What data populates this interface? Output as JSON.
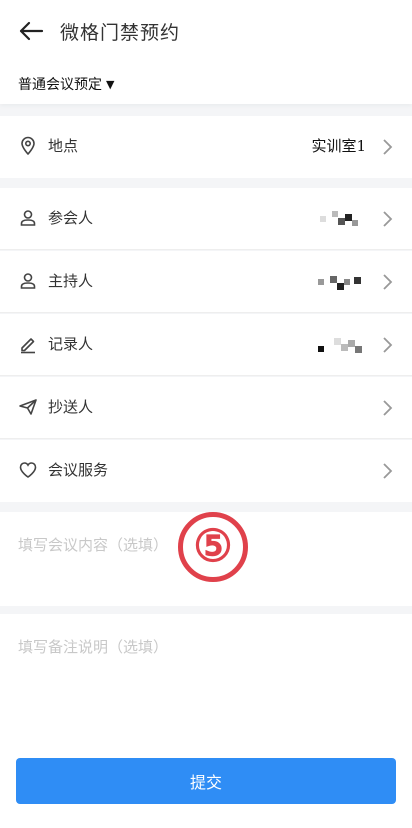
{
  "header": {
    "title": "微格门禁预约",
    "mode_label": "普通会议预定"
  },
  "rows": [
    {
      "id": "location",
      "label": "地点",
      "value": "实训室1",
      "icon": "location-pin-icon"
    },
    {
      "id": "participants",
      "label": "参会人",
      "value": "",
      "icon": "person-icon"
    },
    {
      "id": "host",
      "label": "主持人",
      "value": "",
      "icon": "person-icon"
    },
    {
      "id": "recorder",
      "label": "记录人",
      "value": "",
      "icon": "pencil-icon"
    },
    {
      "id": "cc",
      "label": "抄送人",
      "value": "",
      "icon": "send-icon"
    },
    {
      "id": "service",
      "label": "会议服务",
      "value": "",
      "icon": "heart-icon"
    }
  ],
  "content_field": {
    "placeholder": "填写会议内容（选填）"
  },
  "remark_field": {
    "placeholder": "填写备注说明（选填）"
  },
  "annotation_badge": "⑤",
  "submit_label": "提交",
  "colors": {
    "accent": "#2f8df5",
    "badge": "#e0414b",
    "placeholder": "#c8c8c8"
  }
}
